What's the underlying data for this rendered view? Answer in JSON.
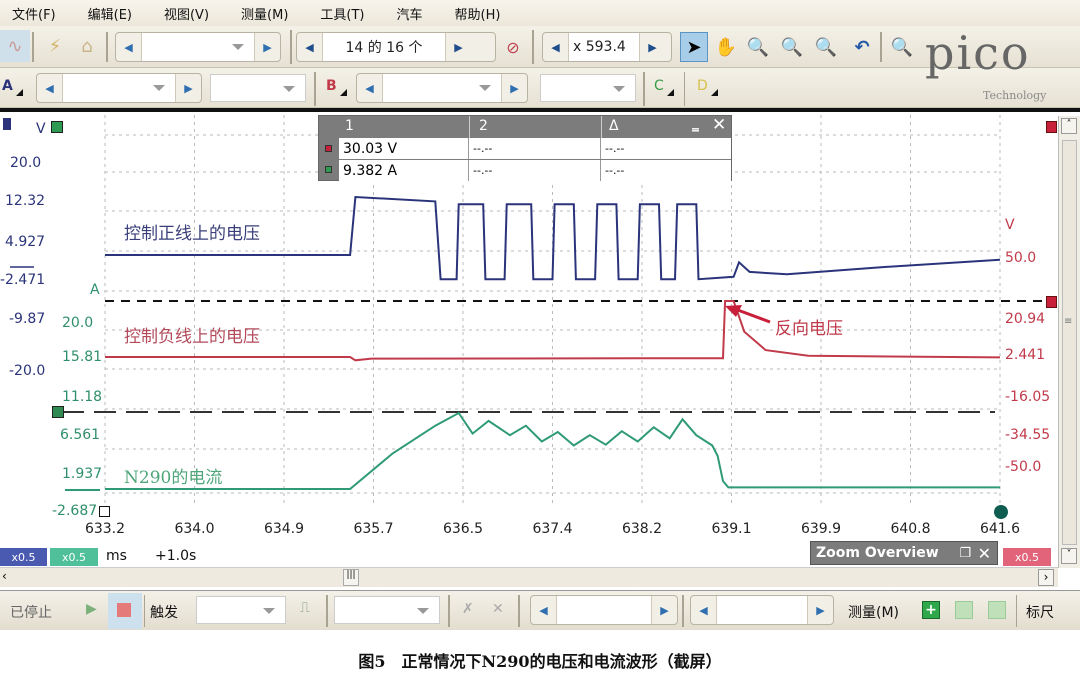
{
  "menu": [
    "文件(F)",
    "编辑(E)",
    "视图(V)",
    "测量(M)",
    "工具(T)",
    "汽车",
    "帮助(H)"
  ],
  "toolbar1": {
    "capture_nav_value": "14 的 16 个",
    "zoom_value": "x 593.4"
  },
  "toolbar2": {
    "channels": [
      "A",
      "B",
      "C",
      "D"
    ]
  },
  "brand": {
    "name": "pico",
    "sub": "Technology"
  },
  "scope": {
    "left_axis_top_unit": "V",
    "left_axis_voltage": [
      "20.0",
      "12.32",
      "4.927",
      "-2.471",
      "-9.87",
      "-20.0"
    ],
    "left_axis_current_unit": "A",
    "left_axis_current": [
      "20.0",
      "15.81",
      "11.18",
      "6.561",
      "1.937",
      "-2.687"
    ],
    "right_axis_unit": "V",
    "right_axis": [
      "50.0",
      "20.94",
      "2.441",
      "-16.05",
      "-34.55",
      "-50.0"
    ],
    "x_ticks": [
      "633.2",
      "634.0",
      "634.9",
      "635.7",
      "636.5",
      "637.4",
      "638.2",
      "639.1",
      "639.9",
      "640.8",
      "641.6"
    ],
    "x_unit": "ms",
    "x_offset": "+1.0s",
    "annotations": {
      "pos_voltage": "控制正线上的电压",
      "neg_voltage": "控制负线上的电压",
      "current": "N290的电流",
      "reverse": "反向电压"
    },
    "colors": {
      "blue": "#2b347a",
      "red": "#c13a4a",
      "green": "#2f9a78"
    }
  },
  "measure_panel": {
    "headers": [
      "1",
      "2",
      "Δ"
    ],
    "rows": [
      {
        "v1": "30.03 V",
        "v2": "--.--",
        "d": "--.--"
      },
      {
        "v1": "9.382 A",
        "v2": "--.--",
        "d": "--.--"
      }
    ]
  },
  "badges": {
    "a": "x0.5",
    "b": "x0.5",
    "c": "x0.5"
  },
  "zoom_overview": {
    "title": "Zoom Overview"
  },
  "bottom": {
    "status": "已停止",
    "trigger_label": "触发",
    "measure_label": "测量(M)",
    "ruler_label": "标尺"
  },
  "caption": "图5　正常情况下N290的电压和电流波形（截屏）",
  "chart_data": {
    "type": "line",
    "xlabel": "ms",
    "x_range": [
      633.2,
      641.6
    ],
    "series": [
      {
        "name": "控制正线上的电压",
        "color": "#2b347a",
        "points": [
          [
            633.2,
            2.5
          ],
          [
            635.5,
            2.5
          ],
          [
            635.55,
            14.5
          ],
          [
            636.3,
            13.6
          ],
          [
            636.35,
            -2.5
          ],
          [
            636.5,
            -2.5
          ],
          [
            636.52,
            13.0
          ],
          [
            636.75,
            13.0
          ],
          [
            636.77,
            -2.5
          ],
          [
            636.95,
            -2.5
          ],
          [
            636.97,
            13.0
          ],
          [
            637.2,
            13.0
          ],
          [
            637.22,
            -2.5
          ],
          [
            637.4,
            -2.5
          ],
          [
            637.42,
            13.0
          ],
          [
            637.6,
            13.0
          ],
          [
            637.62,
            -2.5
          ],
          [
            637.8,
            -2.5
          ],
          [
            637.82,
            13.0
          ],
          [
            638.0,
            13.0
          ],
          [
            638.02,
            -2.5
          ],
          [
            638.2,
            -2.5
          ],
          [
            638.22,
            13.0
          ],
          [
            638.4,
            13.0
          ],
          [
            638.42,
            -2.5
          ],
          [
            638.55,
            -2.5
          ],
          [
            638.57,
            13.0
          ],
          [
            638.75,
            13.0
          ],
          [
            638.77,
            -2.5
          ],
          [
            639.1,
            -2.0
          ],
          [
            639.15,
            1.0
          ],
          [
            639.25,
            -1.0
          ],
          [
            639.6,
            -1.5
          ],
          [
            640.5,
            0
          ],
          [
            641.6,
            1.5
          ]
        ]
      },
      {
        "name": "控制负线上的电压",
        "color": "#c13a4a",
        "points": [
          [
            633.2,
            2.6
          ],
          [
            635.5,
            2.6
          ],
          [
            635.55,
            1.0
          ],
          [
            635.7,
            1.8
          ],
          [
            639.0,
            2.0
          ],
          [
            639.02,
            30.0
          ],
          [
            639.1,
            30.0
          ],
          [
            639.2,
            15
          ],
          [
            639.4,
            6
          ],
          [
            639.8,
            3.2
          ],
          [
            641.6,
            2.4
          ]
        ]
      },
      {
        "name": "N290的电流",
        "color": "#2f9a78",
        "points": [
          [
            633.2,
            0
          ],
          [
            635.5,
            0
          ],
          [
            635.9,
            4.5
          ],
          [
            636.3,
            8
          ],
          [
            636.52,
            9.6
          ],
          [
            636.65,
            7
          ],
          [
            636.8,
            8.6
          ],
          [
            637.0,
            6.8
          ],
          [
            637.15,
            8.0
          ],
          [
            637.3,
            6.0
          ],
          [
            637.45,
            7.2
          ],
          [
            637.6,
            5.5
          ],
          [
            637.75,
            6.8
          ],
          [
            637.9,
            5.6
          ],
          [
            638.05,
            7.3
          ],
          [
            638.2,
            6.0
          ],
          [
            638.35,
            7.8
          ],
          [
            638.5,
            6.4
          ],
          [
            638.62,
            8.8
          ],
          [
            638.75,
            6.8
          ],
          [
            638.9,
            5.5
          ],
          [
            638.95,
            4.2
          ],
          [
            639.0,
            1.0
          ],
          [
            639.05,
            0.2
          ],
          [
            641.6,
            0.2
          ]
        ]
      }
    ],
    "trigger_level_voltage": 30.03,
    "trigger_level_current": 9.382,
    "legend": "inline-annotations"
  }
}
